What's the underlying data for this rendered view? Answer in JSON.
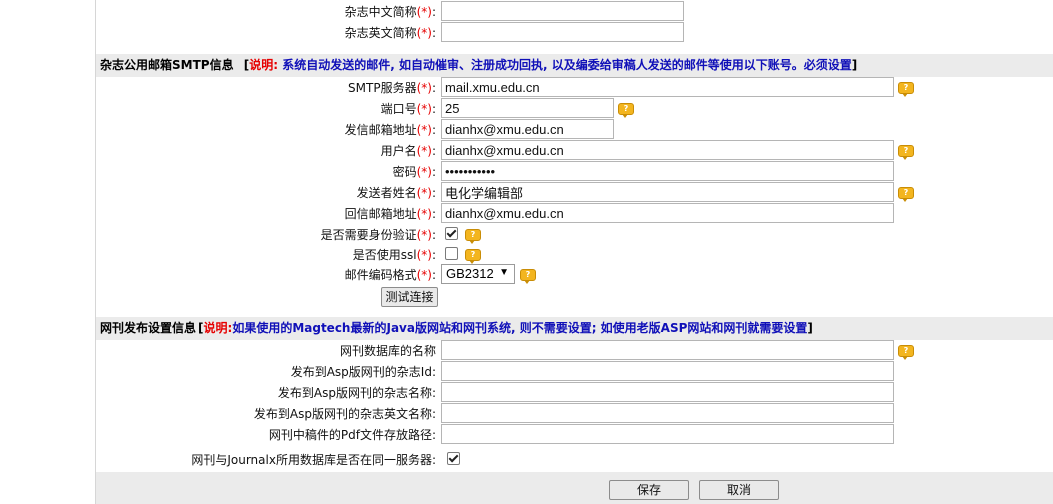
{
  "journal": {
    "cn_abbr_label": "杂志中文简称",
    "en_abbr_label": "杂志英文简称",
    "cn_abbr_value": "",
    "en_abbr_value": ""
  },
  "required_mark": "(*)",
  "help_glyph": "?",
  "smtp": {
    "section_title": "杂志公用邮箱SMTP信息",
    "note_open": "[",
    "note_label": "说明:",
    "note_text": "系统自动发送的邮件, 如自动催审、注册成功回执, 以及编委给审稿人发送的邮件等使用以下账号。必须设置",
    "note_close": "]",
    "server_label": "SMTP服务器",
    "server_value": "mail.xmu.edu.cn",
    "port_label": "端口号",
    "port_value": "25",
    "from_label": "发信邮箱地址",
    "from_value": "dianhx@xmu.edu.cn",
    "user_label": "用户名",
    "user_value": "dianhx@xmu.edu.cn",
    "password_label": "密码",
    "password_value": "•••••••••••",
    "sender_label": "发送者姓名",
    "sender_value": "电化学编辑部",
    "reply_label": "回信邮箱地址",
    "reply_value": "dianhx@xmu.edu.cn",
    "auth_label": "是否需要身份验证",
    "auth_checked": true,
    "ssl_label": "是否使用ssl",
    "ssl_checked": false,
    "encoding_label": "邮件编码格式",
    "encoding_value": "GB2312",
    "test_button": "测试连接"
  },
  "publish": {
    "section_title": "网刊发布设置信息",
    "note_open": "[",
    "note_label": "说明:",
    "note_text": "如果使用的Magtech最新的Java版网站和网刊系统, 则不需要设置; 如使用老版ASP网站和网刊就需要设置",
    "note_close": "]",
    "db_name_label": "网刊数据库的名称",
    "asp_id_label": "发布到Asp版网刊的杂志Id:",
    "asp_name_label": "发布到Asp版网刊的杂志名称:",
    "asp_en_name_label": "发布到Asp版网刊的杂志英文名称:",
    "pdf_path_label": "网刊中稿件的Pdf文件存放路径:",
    "same_server_label": "网刊与Journalx所用数据库是否在同一服务器:",
    "same_server_checked": true
  },
  "actions": {
    "save": "保存",
    "cancel": "取消"
  },
  "colors": {
    "required": "#e60000",
    "note": "#1010b8",
    "section_bg": "#ebebeb",
    "help_icon": "#f3b51f"
  }
}
